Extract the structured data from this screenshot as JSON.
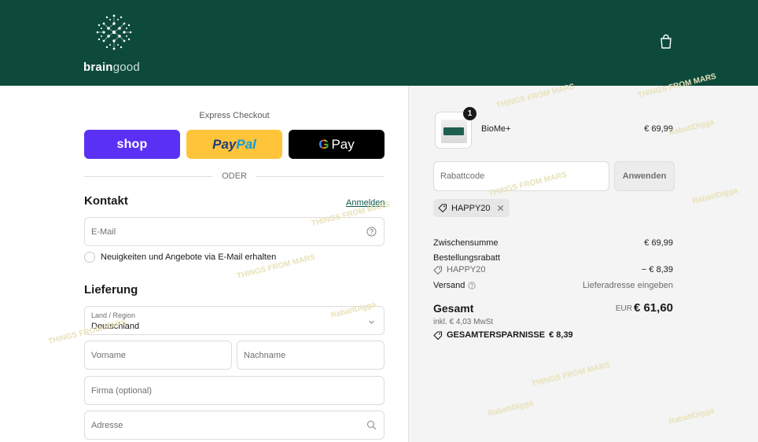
{
  "header": {
    "brand_bold": "brain",
    "brand_light": "good",
    "logo_icon": "brain-dots-logo",
    "cart_icon": "shopping-bag-icon",
    "background": "#0d4a3c"
  },
  "express": {
    "title": "Express Checkout",
    "shop_label": "shop",
    "paypal_part1": "Pay",
    "paypal_part2": "Pal",
    "gpay_g": "G",
    "gpay_label": "Pay",
    "separator": "ODER"
  },
  "contact": {
    "title": "Kontakt",
    "login_link": "Anmelden",
    "email_placeholder": "E-Mail",
    "newsletter_label": "Neuigkeiten und Angebote via E-Mail erhalten"
  },
  "delivery": {
    "title": "Lieferung",
    "country_label": "Land / Region",
    "country_value": "Deutschland",
    "first_name_placeholder": "Vorname",
    "last_name_placeholder": "Nachname",
    "company_placeholder": "Firma (optional)",
    "address_placeholder": "Adresse"
  },
  "order": {
    "product_name": "BioMe+",
    "product_qty": "1",
    "product_price": "€ 69,99",
    "discount_placeholder": "Rabattcode",
    "apply_label": "Anwenden",
    "applied_code": "HAPPY20",
    "subtotal_label": "Zwischensumme",
    "subtotal_value": "€ 69,99",
    "order_discount_label": "Bestellungsrabatt",
    "order_discount_code": "HAPPY20",
    "order_discount_value": "− € 8,39",
    "shipping_label": "Versand",
    "shipping_value": "Lieferadresse eingeben",
    "total_label": "Gesamt",
    "total_currency": "EUR",
    "total_value": "€ 61,60",
    "tax_note": "inkl. € 4,03 MwSt",
    "savings_label": "GESAMTERSPARNISSE",
    "savings_value": "€ 8,39"
  },
  "watermarks": {
    "a": "THINGS FROM MARS",
    "b": "RabattDigga"
  }
}
